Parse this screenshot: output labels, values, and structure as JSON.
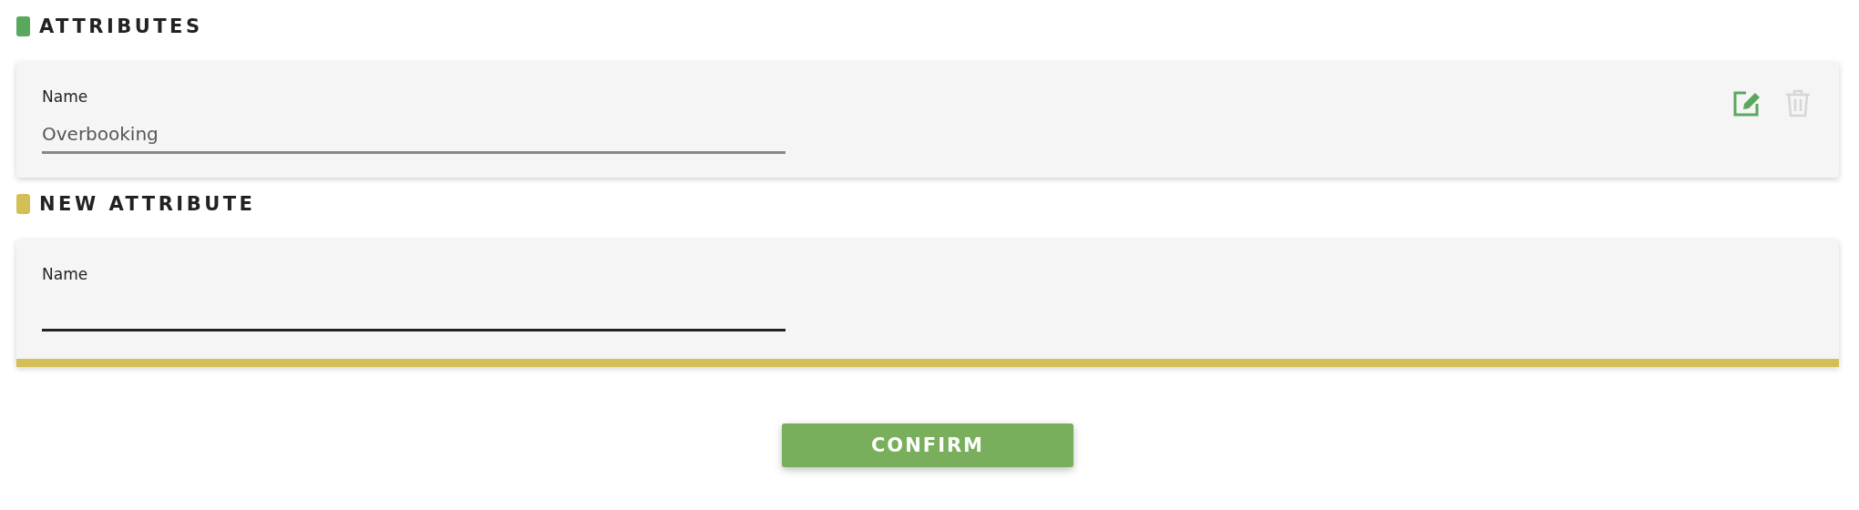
{
  "sections": [
    {
      "title": "ATTRIBUTES",
      "color": "#5aa75e",
      "kind": "existing",
      "fields": [
        {
          "label": "Name",
          "value": "Overbooking",
          "disabled": true
        }
      ],
      "actions": [
        {
          "kind": "edit",
          "disabled": false
        },
        {
          "kind": "delete",
          "disabled": true
        }
      ]
    },
    {
      "title": "NEW ATTRIBUTE",
      "color": "#d4bf57",
      "kind": "new",
      "fields": [
        {
          "label": "Name",
          "disabled": false
        }
      ]
    }
  ],
  "confirm_button": {
    "label": "CONFIRM"
  }
}
